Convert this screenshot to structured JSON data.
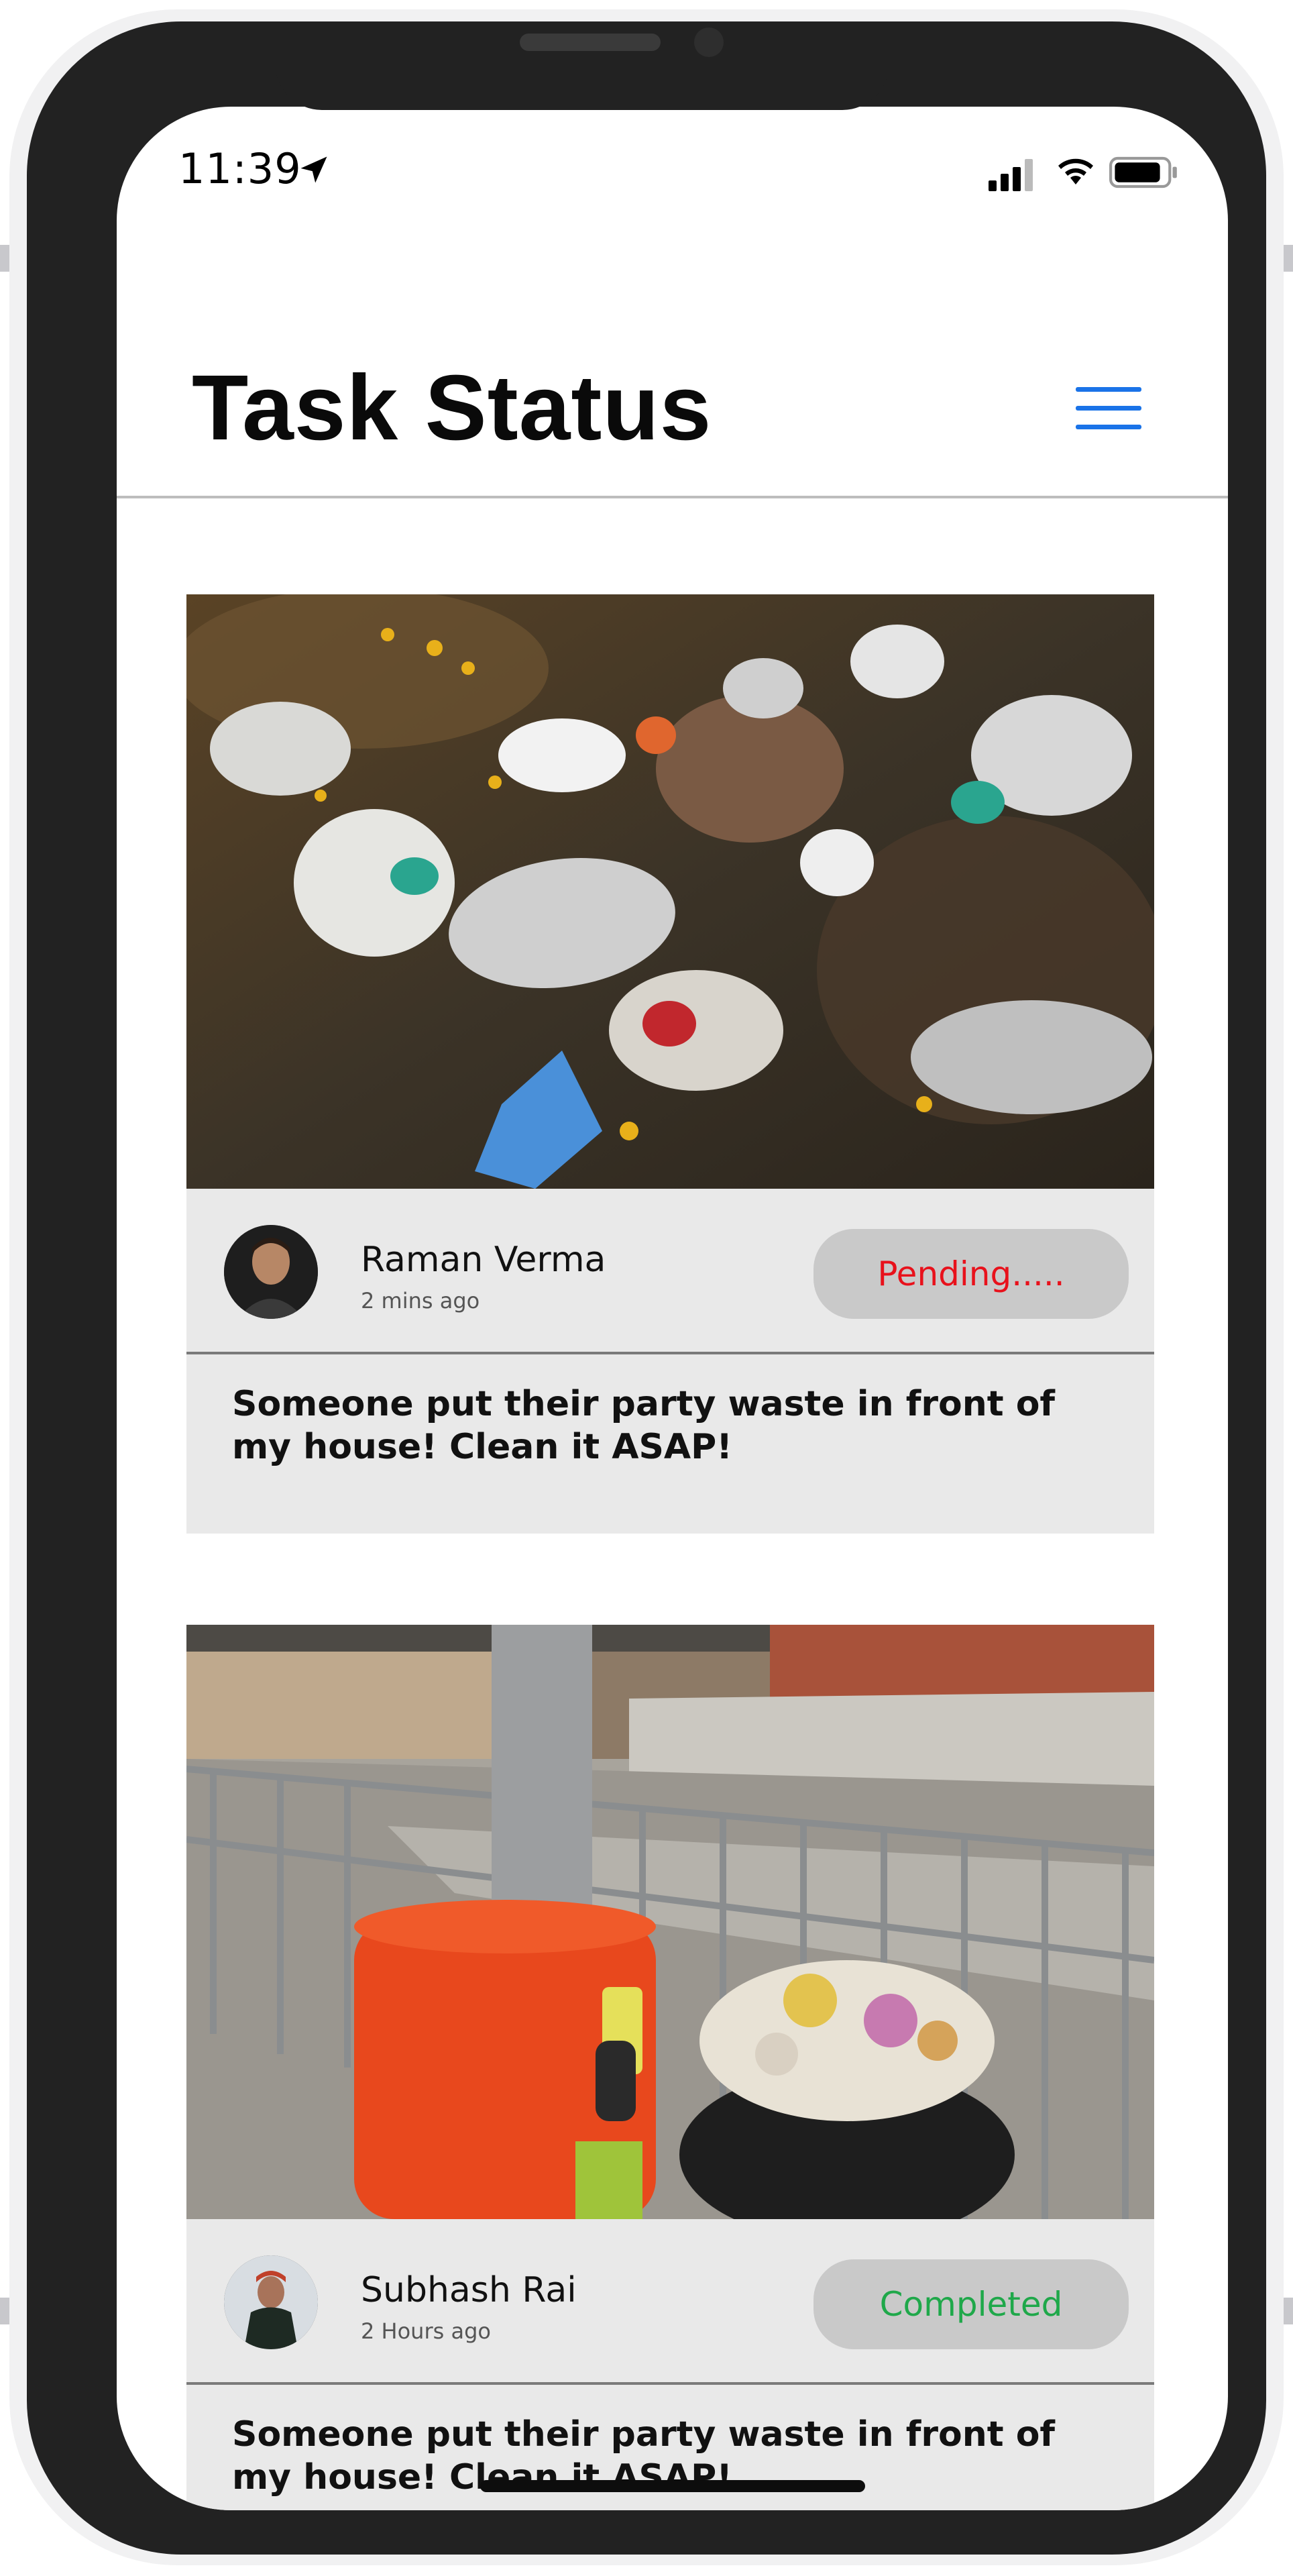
{
  "status_bar": {
    "time": "11:39"
  },
  "header": {
    "title": "Task Status",
    "menu_icon": "hamburger-menu-icon"
  },
  "tasks": [
    {
      "image": "trash-pile-cups-photo",
      "user": "Raman Verma",
      "time_ago": "2 mins ago",
      "status": "Pending.....",
      "status_color": "#e8111b",
      "description": "Someone put their party waste in front of my house! Clean it ASAP!"
    },
    {
      "image": "overflowing-bin-street-photo",
      "user": "Subhash Rai",
      "time_ago": "2 Hours ago",
      "status": "Completed",
      "status_color": "#1fa84a",
      "description": "Someone put their party waste in front of my house! Clean it ASAP!"
    }
  ],
  "colors": {
    "accent": "#1a73e8",
    "card_bg": "#e9e9e9",
    "pill_bg": "#c9c9c9"
  }
}
